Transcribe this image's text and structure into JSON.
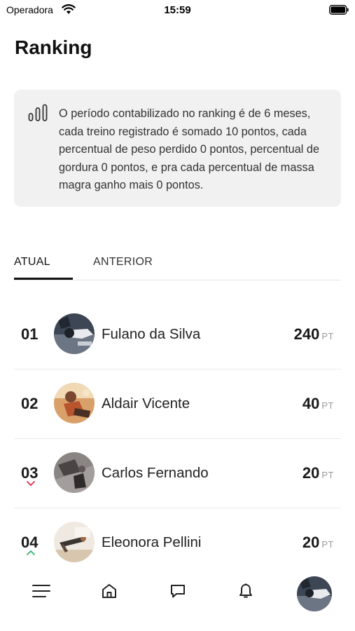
{
  "status_bar": {
    "carrier": "Operadora",
    "time": "15:59"
  },
  "page": {
    "title": "Ranking"
  },
  "info": {
    "text": "O período contabilizado no ranking é de 6 meses, cada treino registrado é somado 10 pontos, cada percentual de peso perdido 0 pontos, percentual de gordura 0 pontos, e pra cada percentual de massa magra ganho mais 0 pontos.",
    "icon": "bar-chart-icon"
  },
  "tabs": [
    {
      "label": "ATUAL",
      "active": true
    },
    {
      "label": "ANTERIOR",
      "active": false
    }
  ],
  "ranking": [
    {
      "position": "01",
      "name": "Fulano da Silva",
      "score": "240",
      "unit": "PT",
      "trend": "none"
    },
    {
      "position": "02",
      "name": "Aldair Vicente",
      "score": "40",
      "unit": "PT",
      "trend": "none"
    },
    {
      "position": "03",
      "name": "Carlos Fernando",
      "score": "20",
      "unit": "PT",
      "trend": "down"
    },
    {
      "position": "04",
      "name": "Eleonora Pellini",
      "score": "20",
      "unit": "PT",
      "trend": "up"
    }
  ],
  "nav": {
    "items": [
      "menu-icon",
      "home-icon",
      "chat-icon",
      "bell-icon",
      "profile-avatar"
    ]
  },
  "colors": {
    "trend_down": "#e0304a",
    "trend_up": "#2bb673",
    "card_bg": "#f1f1f1"
  }
}
